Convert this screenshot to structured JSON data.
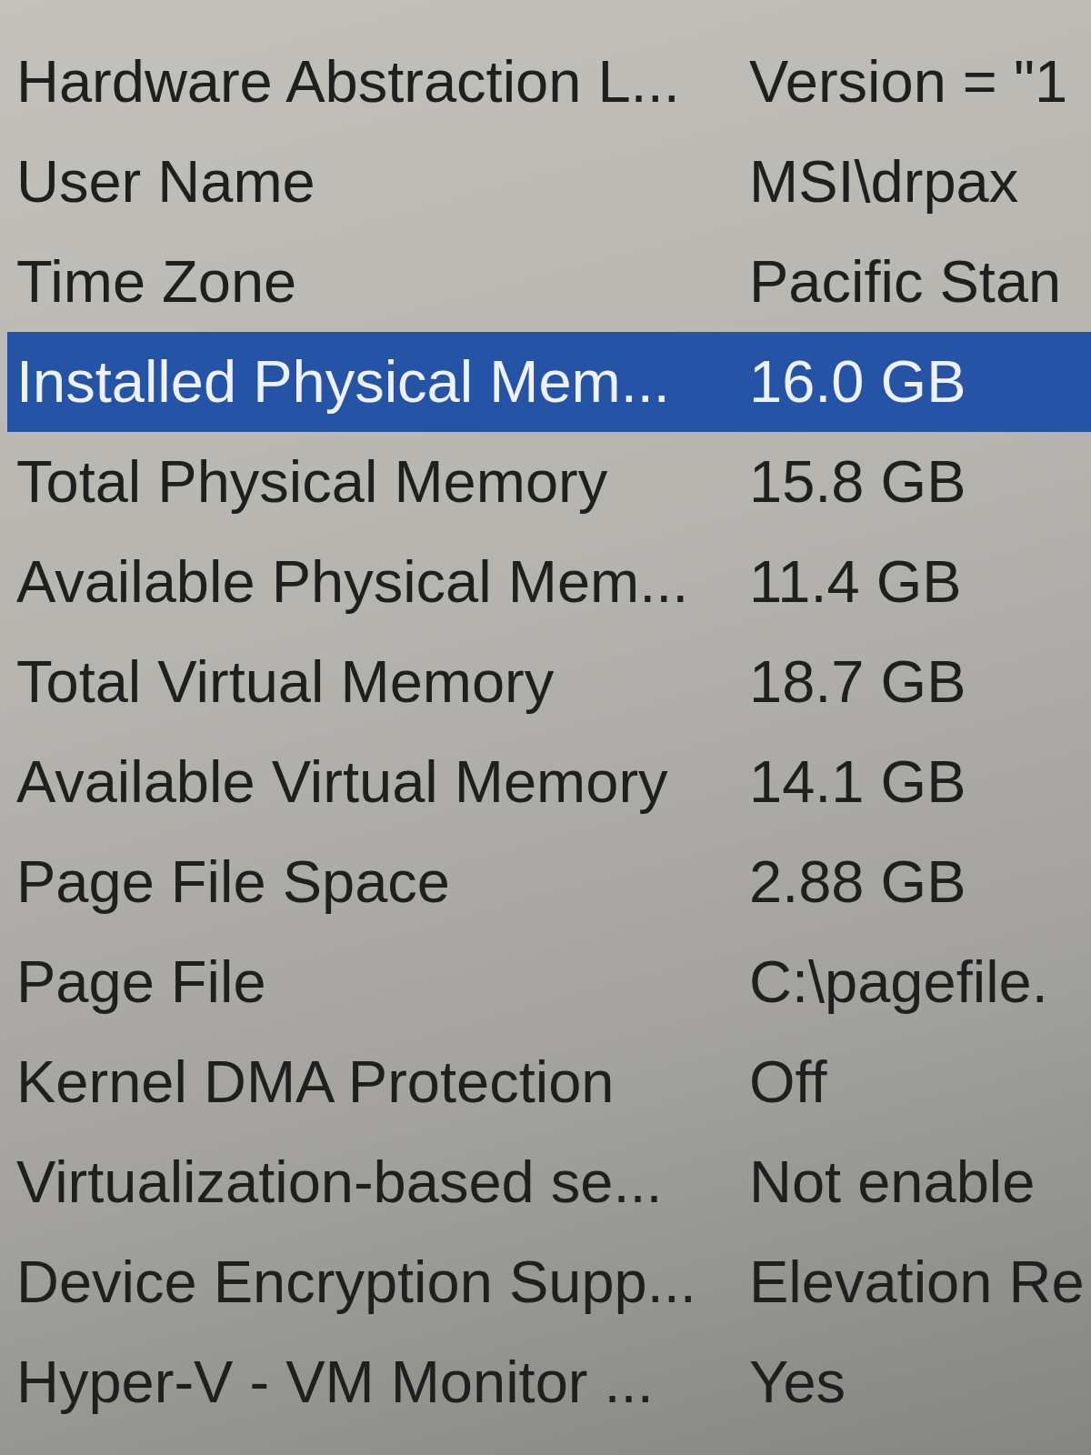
{
  "table": {
    "rows": [
      {
        "column_1": "Hardware Abstraction L...",
        "column_2": "Version = \"1",
        "selected": false
      },
      {
        "column_1": "User Name",
        "column_2": "MSI\\drpax",
        "selected": false
      },
      {
        "column_1": "Time Zone",
        "column_2": "Pacific Stan",
        "selected": false
      },
      {
        "column_1": "Installed Physical Mem...",
        "column_2": "16.0 GB",
        "selected": true
      },
      {
        "column_1": "Total Physical Memory",
        "column_2": "15.8 GB",
        "selected": false
      },
      {
        "column_1": "Available Physical Mem...",
        "column_2": "11.4 GB",
        "selected": false
      },
      {
        "column_1": "Total Virtual Memory",
        "column_2": "18.7 GB",
        "selected": false
      },
      {
        "column_1": "Available Virtual Memory",
        "column_2": "14.1 GB",
        "selected": false
      },
      {
        "column_1": "Page File Space",
        "column_2": "2.88 GB",
        "selected": false
      },
      {
        "column_1": "Page File",
        "column_2": "C:\\pagefile.",
        "selected": false
      },
      {
        "column_1": "Kernel DMA Protection",
        "column_2": "Off",
        "selected": false
      },
      {
        "column_1": "Virtualization-based se...",
        "column_2": "Not enable",
        "selected": false
      },
      {
        "column_1": "Device Encryption Supp...",
        "column_2": "Elevation Re",
        "selected": false
      },
      {
        "column_1": "Hyper-V - VM Monitor ...",
        "column_2": "Yes",
        "selected": false
      }
    ]
  }
}
